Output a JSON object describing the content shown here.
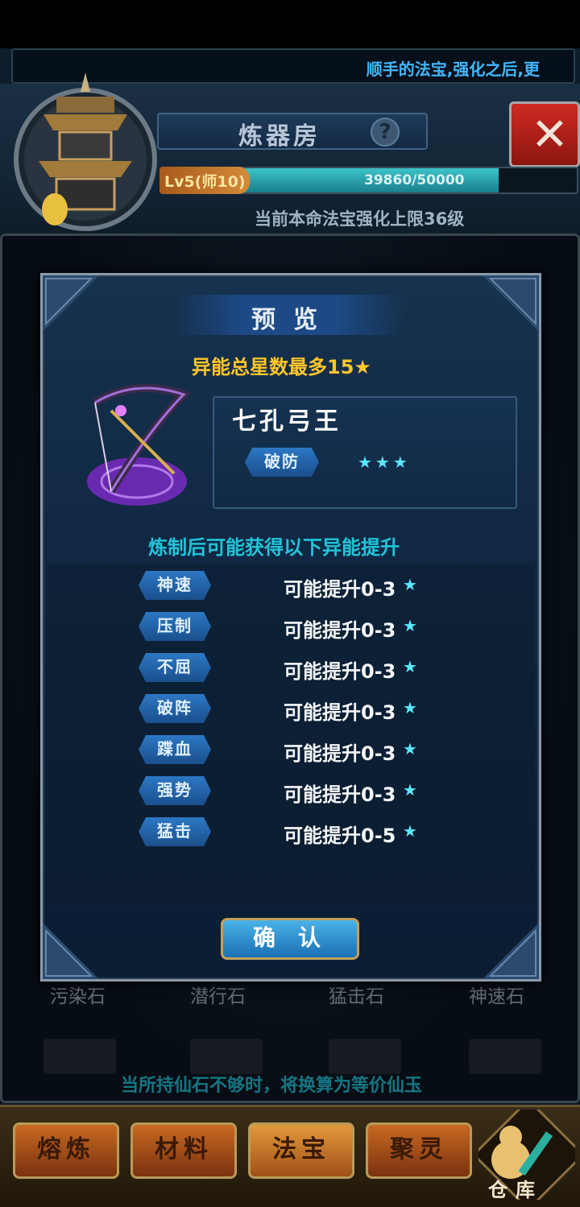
{
  "header": {
    "ticker": "顺手的法宝,强化之后,更",
    "title": "炼器房",
    "help_icon": "?",
    "close_icon": "✕",
    "level_badge": "Lv5(师10)",
    "level_value": "39860/50000",
    "level_progress": 0.797,
    "limit_text": "当前本命法宝强化上限36级"
  },
  "materials": [
    "污染石",
    "潜行石",
    "猛击石",
    "神速石"
  ],
  "convert_note": "当所持仙石不够时，将换算为等价仙玉",
  "bottom_tabs": [
    "熔炼",
    "材料",
    "法宝",
    "聚灵"
  ],
  "storage_label": "仓库",
  "modal": {
    "title": "预览",
    "star_max": "异能总星数最多15★",
    "item": {
      "name": "七孔弓王",
      "tag": "破防",
      "stars": "★★★"
    },
    "subtitle": "炼制后可能获得以下异能提升",
    "rows": [
      {
        "tag": "神速",
        "text": "可能提升0-3",
        "star": "★"
      },
      {
        "tag": "压制",
        "text": "可能提升0-3",
        "star": "★"
      },
      {
        "tag": "不屈",
        "text": "可能提升0-3",
        "star": "★"
      },
      {
        "tag": "破阵",
        "text": "可能提升0-3",
        "star": "★"
      },
      {
        "tag": "蹀血",
        "text": "可能提升0-3",
        "star": "★"
      },
      {
        "tag": "强势",
        "text": "可能提升0-3",
        "star": "★"
      },
      {
        "tag": "猛击",
        "text": "可能提升0-5",
        "star": "★"
      }
    ],
    "confirm_label": "确认"
  },
  "colors": {
    "accent_cyan": "#21c4d8",
    "gold": "#ffc629",
    "star_cyan": "#5ae8ff",
    "ticker_blue": "#41b7ff"
  }
}
